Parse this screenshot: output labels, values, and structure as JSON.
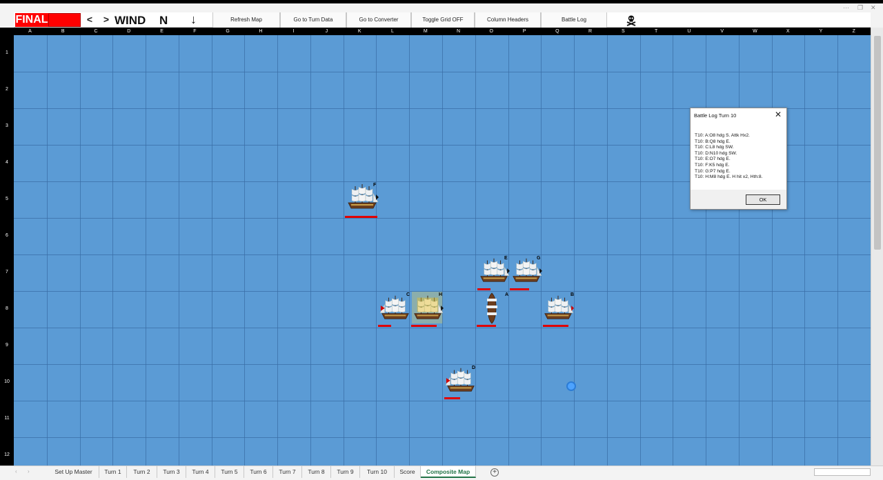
{
  "window": {
    "more_glyph": "···",
    "restore_glyph": "❐",
    "close_glyph": "✕"
  },
  "ribbon": {
    "final_label": "FINAL",
    "prev_label": "<",
    "next_label": ">",
    "wind_label": "WIND",
    "wind_direction": "N",
    "wind_arrow": "↓",
    "buttons": [
      {
        "label": "Refresh Map"
      },
      {
        "label": "Go to Turn Data"
      },
      {
        "label": "Go to Converter"
      },
      {
        "label": "Toggle Grid OFF"
      },
      {
        "label": "Column Headers"
      },
      {
        "label": "Battle Log"
      }
    ],
    "skull_icon": "skull-crossbones-icon"
  },
  "columns": [
    "A",
    "B",
    "C",
    "D",
    "E",
    "F",
    "G",
    "H",
    "I",
    "J",
    "K",
    "L",
    "M",
    "N",
    "O",
    "P",
    "Q",
    "R",
    "S",
    "T",
    "U",
    "V",
    "W",
    "X",
    "Y",
    "Z"
  ],
  "rows": [
    "1",
    "2",
    "3",
    "4",
    "5",
    "6",
    "7",
    "8",
    "9",
    "10",
    "11",
    "12"
  ],
  "map": {
    "color": "#5b9bd5",
    "ships": [
      {
        "id": "F",
        "label": "F"
      },
      {
        "id": "E",
        "label": "E"
      },
      {
        "id": "G",
        "label": "G"
      },
      {
        "id": "C",
        "label": "C"
      },
      {
        "id": "H",
        "label": "H"
      },
      {
        "id": "A",
        "label": "A"
      },
      {
        "id": "B",
        "label": "B"
      },
      {
        "id": "D",
        "label": "D"
      }
    ]
  },
  "dialog": {
    "title": "Battle Log Turn 10",
    "close_glyph": "✕",
    "lines": [
      "T10: A:O8 hdg S.  Attk Hx2.",
      "T10: B:Q8 hdg E.",
      "T10: C:L8 hdg SW.",
      "T10: D:N10 hdg SW.",
      "T10: E:O7 hdg E.",
      "T10: F:K5 hdg E.",
      "T10: G:P7 hdg E.",
      "T10: H:M8 hdg E. H hit x2, Hth:8."
    ],
    "ok_label": "OK"
  },
  "tabs": [
    {
      "label": "Set Up Master"
    },
    {
      "label": "Turn 1"
    },
    {
      "label": "Turn 2"
    },
    {
      "label": "Turn 3"
    },
    {
      "label": "Turn 4"
    },
    {
      "label": "Turn 5"
    },
    {
      "label": "Turn 6"
    },
    {
      "label": "Turn 7"
    },
    {
      "label": "Turn 8"
    },
    {
      "label": "Turn 9"
    },
    {
      "label": "Turn 10"
    },
    {
      "label": "Score"
    },
    {
      "label": "Composite Map",
      "active": true
    }
  ],
  "tab_nav": {
    "prev": "‹",
    "next": "›",
    "add": "+"
  }
}
